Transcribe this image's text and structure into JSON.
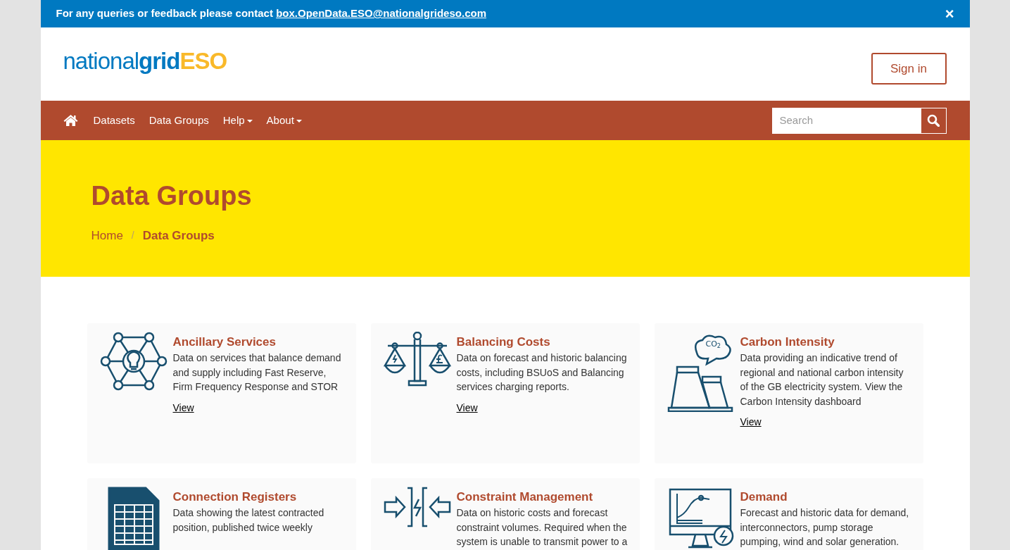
{
  "banner": {
    "text": "For any queries or feedback please contact",
    "link": "box.OpenData.ESO@nationalgrideso.com",
    "close": "×"
  },
  "logo": {
    "part_1": "national",
    "part_2": "grid",
    "part_3": "ESO"
  },
  "sign_in": "Sign in",
  "nav": [
    {
      "label": "Datasets",
      "dropdown": false
    },
    {
      "label": "Data Groups",
      "dropdown": false
    },
    {
      "label": "Help",
      "dropdown": true
    },
    {
      "label": "About",
      "dropdown": true
    }
  ],
  "search": {
    "placeholder": "Search"
  },
  "hero": {
    "title": "Data Groups",
    "separator": "/",
    "breadcrumb": [
      {
        "label": "Home",
        "current": false
      },
      {
        "label": "Data Groups",
        "current": true
      }
    ]
  },
  "groups": [
    {
      "kind": "network",
      "title": "Ancillary Services",
      "description": "Data on services that balance demand and supply including Fast Reserve, Firm Frequency Response and STOR",
      "link": "View"
    },
    {
      "kind": "scales",
      "title": "Balancing Costs",
      "description": "Data on forecast and historic balancing costs, including BSUoS and Balancing services charging reports.",
      "link": "View"
    },
    {
      "kind": "plant",
      "icon_label": "CO$_{2}$",
      "title": "Carbon Intensity",
      "description": "Data providing an indicative trend of regional and national carbon intensity of the GB electricity system. View the Carbon Intensity dashboard",
      "link": "View"
    },
    {
      "kind": "document",
      "title": "Connection Registers",
      "description": "Data showing the latest contracted position, published twice weekly"
    },
    {
      "kind": "constraint",
      "title": "Constraint Management",
      "description": "Data on historic costs and forecast constraint volumes. Required when the system is unable to transmit power to a"
    },
    {
      "kind": "monitor",
      "title": "Demand",
      "description": "Forecast and historic data for demand, interconnectors, pump storage pumping, wind and solar generation."
    }
  ]
}
